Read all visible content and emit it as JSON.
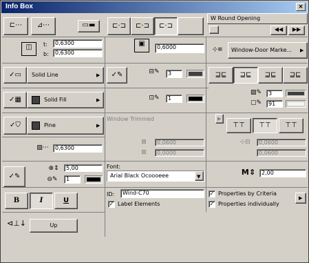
{
  "window": {
    "title": "Info Box",
    "close_glyph": "×"
  },
  "opening": {
    "type_label": "W Round Opening",
    "nav_prev": "◀◀",
    "nav_next": "▶▶"
  },
  "dimensions": {
    "width_label": "t:",
    "width_value": "0,6300",
    "height_label": "b:",
    "height_value": "0,6300"
  },
  "sill": {
    "value": "0,6000"
  },
  "marker": {
    "label": "Window-Door Marke..."
  },
  "line": {
    "label": "Solid Line",
    "pen_value": "3"
  },
  "fill": {
    "label": "Solid Fill",
    "pen_value": "1"
  },
  "material": {
    "label": "Pine"
  },
  "trim": {
    "label": "Window Trimmed",
    "value1": "0,0600",
    "value2": "0,0000",
    "value3": "0,0600",
    "value4": "0,0600"
  },
  "fill_pens": {
    "pen1": "3",
    "pen2": "91"
  },
  "offset": {
    "value": "0,6300"
  },
  "text": {
    "size": "5,00",
    "pen": "1",
    "font_label": "Font:",
    "font_value": "Arial Black Ocoooeee",
    "rotation": "2,00"
  },
  "id": {
    "label": "ID:",
    "value": "Wind-C70"
  },
  "checks": {
    "label_elements": "Label Elements",
    "by_criteria": "Properties by Criteria",
    "individually": "Properties individually"
  },
  "style": {
    "bold": "B",
    "italic": "I",
    "underline": "U"
  },
  "orientation": {
    "value": "Up"
  },
  "colors": {
    "titlebar": "#0a246a",
    "face": "#d4d0c8",
    "swatch_fill": "#404040"
  }
}
